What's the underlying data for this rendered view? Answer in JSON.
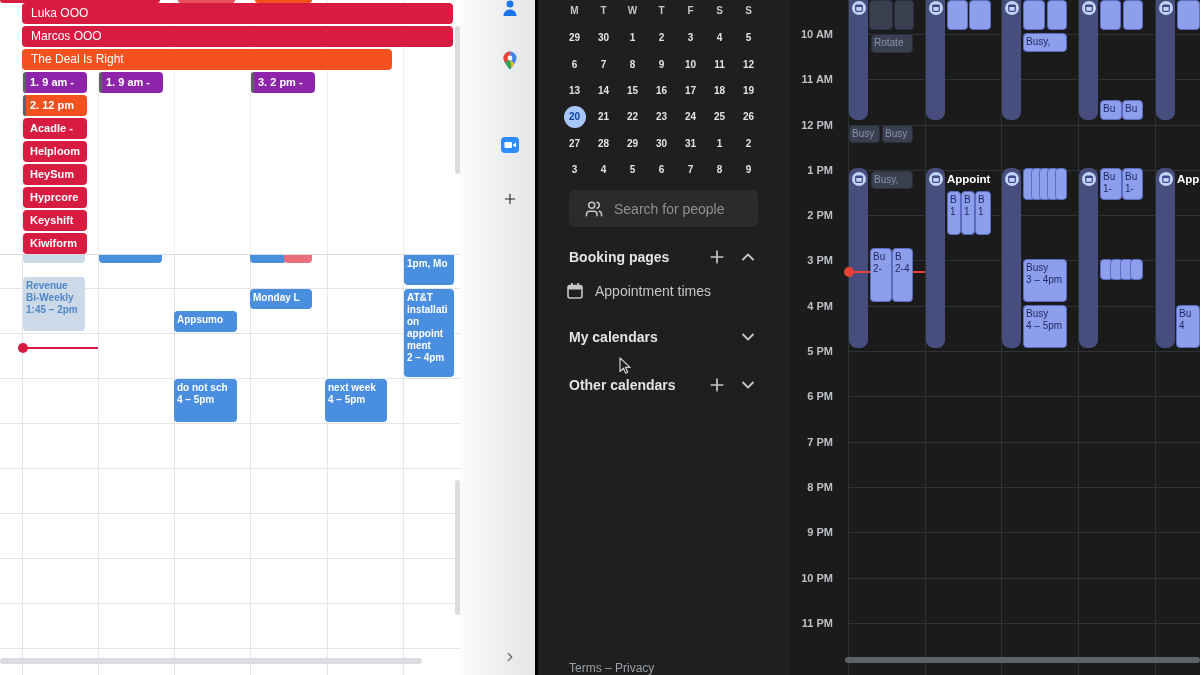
{
  "left_calendar": {
    "top_cut_events": [
      {
        "color": "#d81b40"
      },
      {
        "color": "#e8505b"
      },
      {
        "color": "#f4511e"
      }
    ],
    "spanning_events": [
      {
        "title": "Luka OOO",
        "color": "#d81b40"
      },
      {
        "title": "Marcos OOO",
        "color": "#d81b40"
      },
      {
        "title": "The Deal Is Right",
        "color": "#f4511e"
      }
    ],
    "days": [
      {
        "now_line": true,
        "all_day": [
          {
            "title": "1. 9 am -",
            "color": "#8e24aa",
            "side_stripe": true
          },
          {
            "title": "2. 12 pm",
            "color": "#f4511e",
            "side_stripe": true
          },
          {
            "title": "Acadle -",
            "color": "#d81b40",
            "side_stripe": false
          },
          {
            "title": "Helploom",
            "color": "#d81b40",
            "side_stripe": false
          },
          {
            "title": "HeySum",
            "color": "#d81b40",
            "side_stripe": false
          },
          {
            "title": "Hyprcore",
            "color": "#d81b40",
            "side_stripe": false
          },
          {
            "title": "Keyshift",
            "color": "#d81b40",
            "side_stripe": false
          },
          {
            "title": "Kiwiform",
            "color": "#d81b40",
            "side_stripe": false
          }
        ],
        "events": [
          {
            "kind": "pale",
            "color": "#cbd9e9"
          },
          {
            "kind": "pale",
            "title": "Revenue Bi-Weekly",
            "time": "1:45 – 2pm",
            "color": "#cbd9e9"
          }
        ]
      },
      {
        "now_line": false,
        "all_day": [
          {
            "title": "1. 9 am -",
            "color": "#8e24aa",
            "side_stripe": true
          }
        ],
        "events": [
          {
            "kind": "solid",
            "color": "#4a8ee0"
          }
        ]
      },
      {
        "now_line": false,
        "events": [
          {
            "kind": "solid",
            "title": "Appsumo",
            "color": "#4a8ee0"
          },
          {
            "kind": "solid",
            "title": "do not sch",
            "time": "4 – 5pm",
            "color": "#4a8ee0"
          }
        ]
      },
      {
        "now_line": false,
        "all_day": [
          {
            "title": "3. 2 pm -",
            "color": "#8e24aa",
            "side_stripe": true
          }
        ],
        "events": [
          {
            "kind": "solid",
            "color": "#4a8ee0"
          },
          {
            "kind": "solid",
            "color": "#e8707c"
          },
          {
            "kind": "solid",
            "title": "Monday L",
            "color": "#4a8ee0"
          }
        ]
      },
      {
        "now_line": false,
        "events": [
          {
            "kind": "solid",
            "title": "next week",
            "time": "4 – 5pm",
            "color": "#4a8ee0"
          }
        ]
      },
      {
        "now_line": false,
        "events": [
          {
            "kind": "solid",
            "title": "1pm, Mo",
            "color": "#4a8ee0"
          },
          {
            "kind": "solid",
            "title": "AT&T installation appointment",
            "time": "2 – 4pm",
            "color": "#4a8ee0"
          }
        ]
      }
    ]
  },
  "sidebar": {
    "mini_calendar": {
      "weekdays": [
        "M",
        "T",
        "W",
        "T",
        "F",
        "S",
        "S"
      ],
      "dates": [
        {
          "label": "29",
          "selected": false
        },
        {
          "label": "30",
          "selected": false
        },
        {
          "label": "1",
          "selected": false
        },
        {
          "label": "2",
          "selected": false
        },
        {
          "label": "3",
          "selected": false
        },
        {
          "label": "4",
          "selected": false
        },
        {
          "label": "5",
          "selected": false
        },
        {
          "label": "6",
          "selected": false
        },
        {
          "label": "7",
          "selected": false
        },
        {
          "label": "8",
          "selected": false
        },
        {
          "label": "9",
          "selected": false
        },
        {
          "label": "10",
          "selected": false
        },
        {
          "label": "11",
          "selected": false
        },
        {
          "label": "12",
          "selected": false
        },
        {
          "label": "13",
          "selected": false
        },
        {
          "label": "14",
          "selected": false
        },
        {
          "label": "15",
          "selected": false
        },
        {
          "label": "16",
          "selected": false
        },
        {
          "label": "17",
          "selected": false
        },
        {
          "label": "18",
          "selected": false
        },
        {
          "label": "19",
          "selected": false
        },
        {
          "label": "20",
          "selected": true
        },
        {
          "label": "21",
          "selected": false
        },
        {
          "label": "22",
          "selected": false
        },
        {
          "label": "23",
          "selected": false
        },
        {
          "label": "24",
          "selected": false
        },
        {
          "label": "25",
          "selected": false
        },
        {
          "label": "26",
          "selected": false
        },
        {
          "label": "27",
          "selected": false
        },
        {
          "label": "28",
          "selected": false
        },
        {
          "label": "29",
          "selected": false
        },
        {
          "label": "30",
          "selected": false
        },
        {
          "label": "31",
          "selected": false
        },
        {
          "label": "1",
          "selected": false
        },
        {
          "label": "2",
          "selected": false
        },
        {
          "label": "3",
          "selected": false
        },
        {
          "label": "4",
          "selected": false
        },
        {
          "label": "5",
          "selected": false
        },
        {
          "label": "6",
          "selected": false
        },
        {
          "label": "7",
          "selected": false
        },
        {
          "label": "8",
          "selected": false
        },
        {
          "label": "9",
          "selected": false
        }
      ]
    },
    "search": {
      "placeholder": "Search for people"
    },
    "sections": [
      {
        "title": "Booking pages",
        "add_button": true,
        "expanded": true,
        "items": [
          {
            "label": "Appointment times"
          }
        ]
      },
      {
        "title": "My calendars",
        "add_button": false,
        "expanded": false
      },
      {
        "title": "Other calendars",
        "add_button": true,
        "expanded": false
      }
    ],
    "footer": "Terms – Privacy"
  },
  "right_calendar": {
    "time_labels": [
      "10 AM",
      "11 AM",
      "12 PM",
      "1 PM",
      "2 PM",
      "3 PM",
      "4 PM",
      "5 PM",
      "6 PM",
      "7 PM",
      "8 PM",
      "9 PM",
      "10 PM",
      "11 PM"
    ],
    "days": [
      {
        "now_line": true,
        "events": [
          {
            "muted": true
          },
          {
            "muted": true
          },
          {
            "title": "Rotate",
            "muted": true
          },
          {
            "title": "Busy",
            "muted": true
          },
          {
            "title": "Busy",
            "muted": true
          },
          {
            "title": "Busy,",
            "muted": true
          },
          {
            "title": "Bu",
            "time": "2-",
            "muted": false
          },
          {
            "title": "B",
            "time": "2-4",
            "muted": false
          }
        ]
      },
      {
        "now_line": false,
        "booking_title": "Appoint",
        "events": [
          {
            "muted": false
          },
          {
            "muted": false
          },
          {
            "title": "B",
            "time": "1",
            "muted": false
          },
          {
            "title": "B",
            "time": "1",
            "muted": false
          },
          {
            "title": "B",
            "time": "1",
            "muted": false
          }
        ]
      },
      {
        "now_line": false,
        "events": [
          {
            "muted": false
          },
          {
            "muted": false
          },
          {
            "title": "Busy,",
            "muted": false
          },
          {
            "muted": false
          },
          {
            "muted": false
          },
          {
            "muted": false
          },
          {
            "muted": false
          },
          {
            "muted": false
          },
          {
            "title": "Busy",
            "time": "3 – 4pm",
            "muted": false
          },
          {
            "title": "Busy",
            "time": "4 – 5pm",
            "muted": false
          }
        ]
      },
      {
        "now_line": false,
        "events": [
          {
            "muted": false
          },
          {
            "muted": false
          },
          {
            "title": "Bu",
            "muted": false
          },
          {
            "title": "Bu",
            "muted": false
          },
          {
            "title": "Bu",
            "time": "1-",
            "muted": false
          },
          {
            "title": "Bu",
            "time": "1-",
            "muted": false
          },
          {
            "muted": false
          },
          {
            "muted": false
          },
          {
            "muted": false
          },
          {
            "muted": false
          }
        ]
      },
      {
        "now_line": false,
        "booking_title": "App",
        "events": [
          {
            "muted": false
          },
          {
            "title": "Bu",
            "time": "4",
            "muted": false
          }
        ]
      }
    ]
  }
}
